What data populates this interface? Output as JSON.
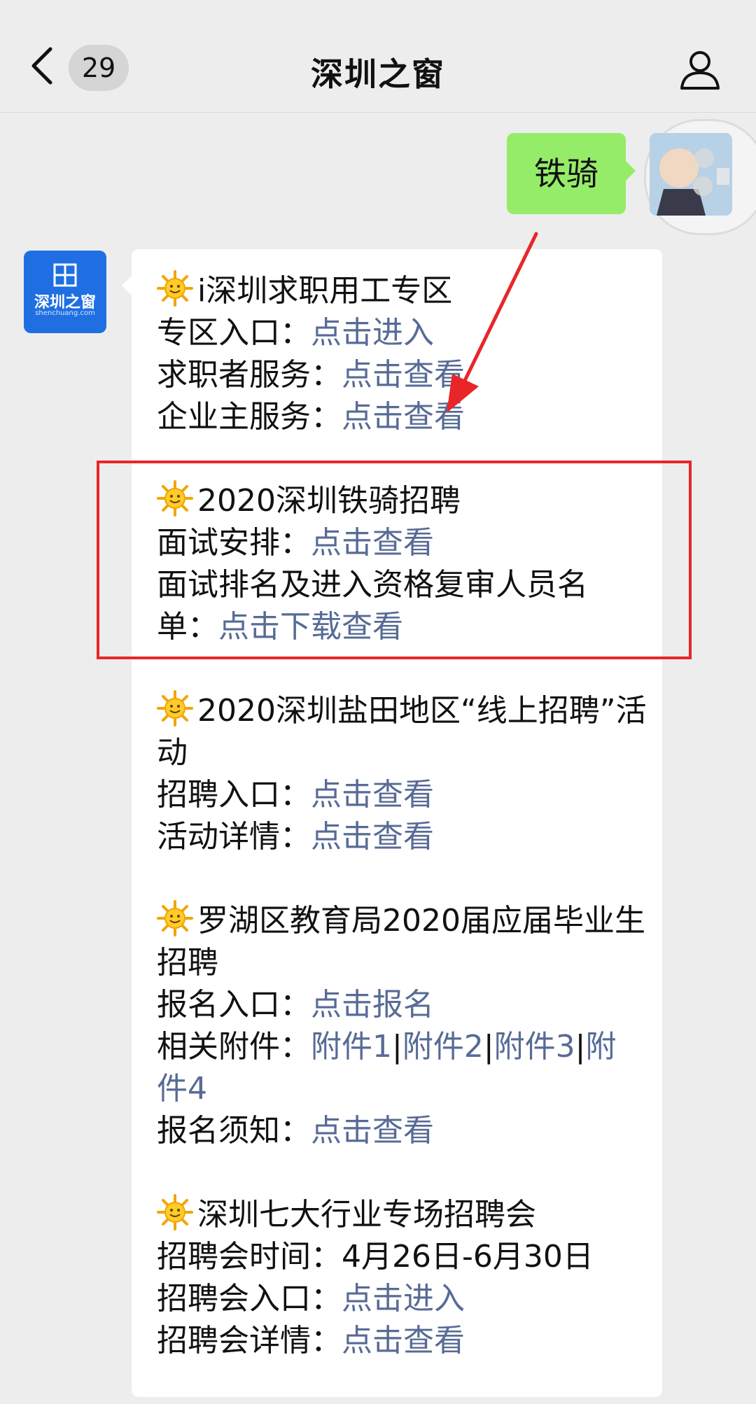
{
  "nav": {
    "back_badge_count": "29",
    "title": "深圳之窗"
  },
  "self_message": {
    "text": "铁骑"
  },
  "official_avatar": {
    "logo_text": "深圳之窗",
    "logo_sub": "shenchuang.com"
  },
  "sections": [
    {
      "title": "i深圳求职用工专区",
      "lines": [
        {
          "label": "专区入口：",
          "links": [
            "点击进入"
          ]
        },
        {
          "label": "求职者服务：",
          "links": [
            "点击查看"
          ]
        },
        {
          "label": "企业主服务：",
          "links": [
            "点击查看"
          ]
        }
      ]
    },
    {
      "title": "2020深圳铁骑招聘",
      "lines": [
        {
          "label": "面试安排：",
          "links": [
            "点击查看"
          ]
        },
        {
          "label": "面试排名及进入资格复审人员名单：",
          "links": [
            "点击下载查看"
          ]
        }
      ]
    },
    {
      "title": "2020深圳盐田地区“线上招聘”活动",
      "lines": [
        {
          "label": "招聘入口：",
          "links": [
            "点击查看"
          ]
        },
        {
          "label": "活动详情：",
          "links": [
            "点击查看"
          ]
        }
      ]
    },
    {
      "title": "罗湖区教育局2020届应届毕业生招聘",
      "lines": [
        {
          "label": "报名入口：",
          "links": [
            "点击报名"
          ]
        },
        {
          "label": "相关附件：",
          "links": [
            "附件1",
            "附件2",
            "附件3",
            "附件4"
          ]
        },
        {
          "label": "报名须知：",
          "links": [
            "点击查看"
          ]
        }
      ]
    },
    {
      "title": "深圳七大行业专场招聘会",
      "lines": [
        {
          "label": "招聘会时间：4月26日-6月30日",
          "links": []
        },
        {
          "label": "招聘会入口：",
          "links": [
            "点击进入"
          ]
        },
        {
          "label": "招聘会详情：",
          "links": [
            "点击查看"
          ]
        }
      ]
    }
  ],
  "colors": {
    "link": "#576b95",
    "self_bubble": "#95ec69",
    "highlight": "#e8262a",
    "background": "#ededed"
  }
}
